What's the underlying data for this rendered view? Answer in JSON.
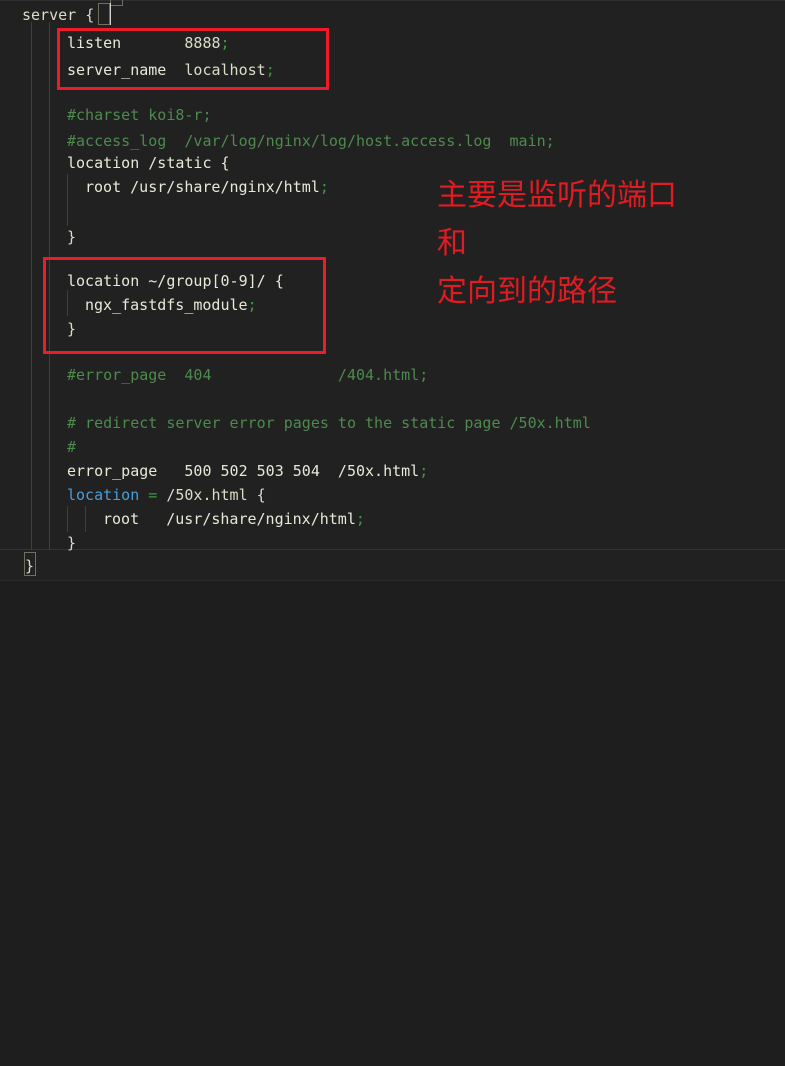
{
  "editor": {
    "language": "nginx-conf",
    "theme": "dark-plus",
    "background_color": "#212121",
    "foreground_color": "#dcdcc8",
    "comment_color": "#4e8a4e",
    "keyword_color": "#4a9ddb",
    "punctuation_color": "#3f9a3f"
  },
  "code": {
    "lines": [
      {
        "indent": 0,
        "text": "server {"
      },
      {
        "indent": 0,
        "text": "    listen       8888;"
      },
      {
        "indent": 0,
        "text": "    server_name  localhost;"
      },
      {
        "indent": 0,
        "text": ""
      },
      {
        "indent": 0,
        "text": "    #charset koi8-r;"
      },
      {
        "indent": 0,
        "text": "    #access_log  /var/log/nginx/log/host.access.log  main;"
      },
      {
        "indent": 0,
        "text": "    location /static {"
      },
      {
        "indent": 0,
        "text": "      root /usr/share/nginx/html;"
      },
      {
        "indent": 0,
        "text": ""
      },
      {
        "indent": 0,
        "text": "    }"
      },
      {
        "indent": 0,
        "text": ""
      },
      {
        "indent": 0,
        "text": "    location ~/group[0-9]/ {"
      },
      {
        "indent": 0,
        "text": "      ngx_fastdfs_module;"
      },
      {
        "indent": 0,
        "text": "    }"
      },
      {
        "indent": 0,
        "text": ""
      },
      {
        "indent": 0,
        "text": "    #error_page  404              /404.html;"
      },
      {
        "indent": 0,
        "text": ""
      },
      {
        "indent": 0,
        "text": "    # redirect server error pages to the static page /50x.html"
      },
      {
        "indent": 0,
        "text": "    #"
      },
      {
        "indent": 0,
        "text": "    error_page   500 502 503 504  /50x.html;"
      },
      {
        "indent": 0,
        "text": "    location = /50x.html {"
      },
      {
        "indent": 0,
        "text": "        root   /usr/share/nginx/html;"
      },
      {
        "indent": 0,
        "text": "    }"
      },
      {
        "indent": 0,
        "text": "}"
      }
    ],
    "tokens": {
      "l1_server": "server ",
      "l1_brace": "{",
      "l2_key": "listen",
      "l2_gap": "       ",
      "l2_val": "8888",
      "l2_semi": ";",
      "l3_key": "server_name",
      "l3_gap": "  ",
      "l3_val": "localhost",
      "l3_semi": ";",
      "l5_comment": "#charset koi8-r;",
      "l6_comment": "#access_log  /var/log/nginx/log/host.access.log  main;",
      "l7_key": "location /static {",
      "l8_key": "root /usr/share/nginx/html",
      "l8_semi": ";",
      "l10_brace": "}",
      "l12_key": "location ~/group[0-9]/ {",
      "l13_key": "ngx_fastdfs_module",
      "l13_semi": ";",
      "l14_brace": "}",
      "l16_comment": "#error_page  404              /404.html;",
      "l18_comment": "# redirect server error pages to the static page /50x.html",
      "l19_comment": "#",
      "l20_key": "error_page   500 502 503 504  /50x.html",
      "l20_semi": ";",
      "l21_kw": "location",
      "l21_eq": " = ",
      "l21_val": "/50x.html {",
      "l22_key": "root   /usr/share/nginx/html",
      "l22_semi": ";",
      "l23_brace": "}",
      "l24_brace": "}"
    }
  },
  "annotations": {
    "box_color": "#ee1c28",
    "text_color": "#e01b22",
    "boxes": [
      {
        "name": "listen-server-name-highlight",
        "label": "listen / server_name block"
      },
      {
        "name": "fastdfs-location-highlight",
        "label": "location ~/group[0-9]/ block"
      }
    ],
    "notes": [
      {
        "line1": "主要是监听的端口",
        "line2": "和",
        "line3": "定向到的路径"
      }
    ],
    "note_full_text": "主要是监听的端口和\n定向到的路径"
  }
}
